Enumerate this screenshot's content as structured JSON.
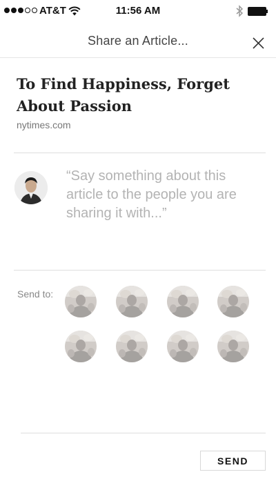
{
  "status_bar": {
    "carrier": "AT&T",
    "time": "11:56 AM",
    "icons": [
      "signal-dots",
      "wifi-icon",
      "bluetooth-icon",
      "battery-icon"
    ]
  },
  "header": {
    "title": "Share an Article...",
    "close_icon": "close-icon"
  },
  "article": {
    "title": "To Find Happiness, Forget About Passion",
    "source": "nytimes.com"
  },
  "comment": {
    "placeholder": "“Say something about this article to the people you are sharing it with...”"
  },
  "recipients": {
    "label": "Send to:",
    "count": 8
  },
  "actions": {
    "send_label": "SEND"
  },
  "colors": {
    "text_primary": "#222222",
    "text_secondary": "#777777",
    "placeholder": "#b3b3b3",
    "divider": "#dedede"
  }
}
